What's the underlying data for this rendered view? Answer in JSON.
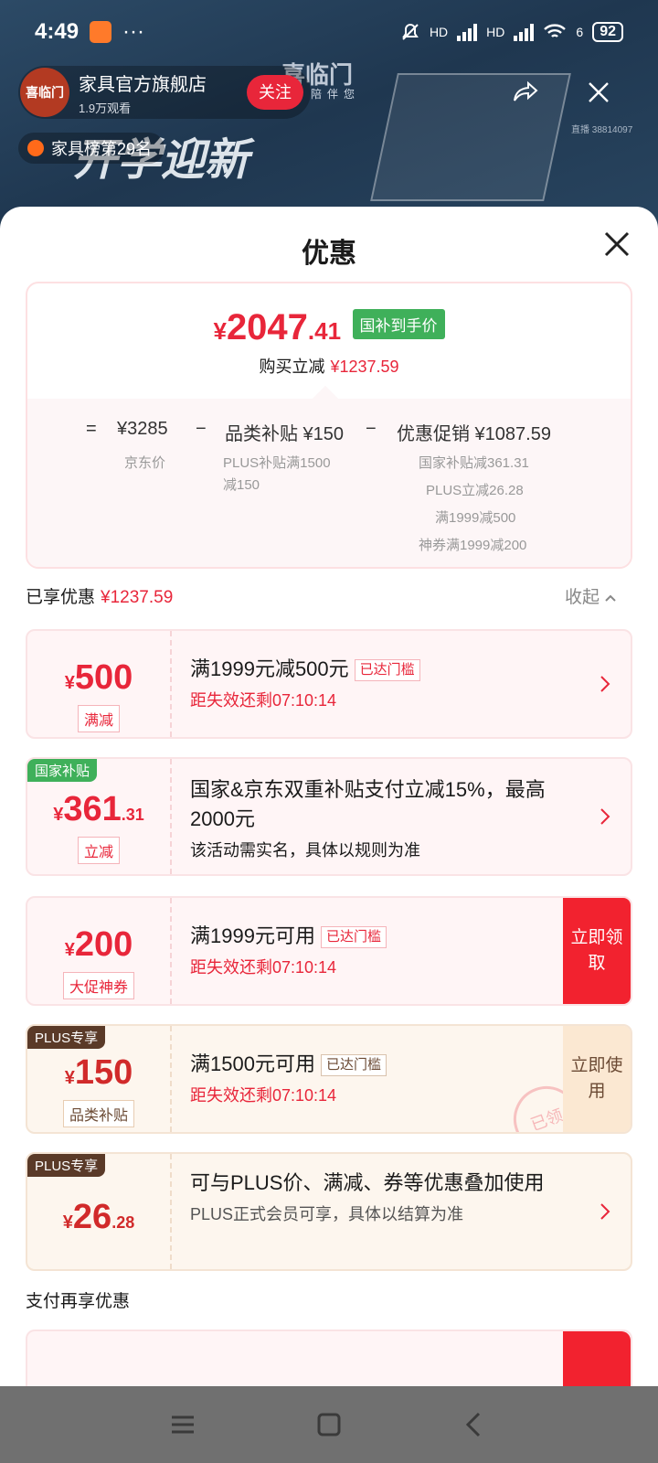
{
  "status_bar": {
    "time": "4:49",
    "hd1": "HD",
    "hd2": "HD",
    "wifi_num": "6",
    "battery": "92"
  },
  "live": {
    "store_name": "家具官方旗舰店",
    "views": "1.9万观看",
    "follow_label": "关注",
    "rank_label": "家具榜第29名",
    "brand": "喜临门",
    "brand_sub": "陪伴您",
    "banner_text": "开学迎新",
    "room_id": "直播 38814097",
    "logo_text": "喜临门"
  },
  "sheet": {
    "title": "优惠",
    "price": {
      "currency": "¥",
      "integer": "2047",
      "decimal": ".41",
      "tag": "国补到手价",
      "reduce_label": "购买立减",
      "reduce_value": "¥1237.59"
    },
    "equation": {
      "eq": "=",
      "base_price": "¥3285",
      "base_label": "京东价",
      "minus1": "−",
      "category_label": "品类补贴 ¥150",
      "category_sub1": "PLUS补贴满1500",
      "category_sub2": "减150",
      "minus2": "−",
      "promo_label": "优惠促销 ¥1087.59",
      "promo_sub1": "国家补贴减361.31",
      "promo_sub2": "PLUS立减26.28",
      "promo_sub3": "满1999减500",
      "promo_sub4": "神券满1999减200"
    },
    "applied_label": "已享优惠",
    "applied_value": "¥1237.59",
    "collapse_label": "收起",
    "cards": [
      {
        "currency": "¥",
        "amount": "500",
        "decimal": "",
        "type": "满减",
        "ribbon": "",
        "title": "满1999元减500元",
        "badge": "已达门槛",
        "sub": "距失效还剩07:10:14",
        "action": ""
      },
      {
        "currency": "¥",
        "amount": "361",
        "decimal": ".31",
        "type": "立减",
        "ribbon": "国家补贴",
        "title": "国家&京东双重补贴支付立减15%，最高2000元",
        "badge": "",
        "sub": "该活动需实名，具体以规则为准",
        "action": ""
      },
      {
        "currency": "¥",
        "amount": "200",
        "decimal": "",
        "type": "大促神券",
        "ribbon": "",
        "title": "满1999元可用",
        "badge": "已达门槛",
        "sub": "距失效还剩07:10:14",
        "action": "立即领取"
      },
      {
        "currency": "¥",
        "amount": "150",
        "decimal": "",
        "type": "品类补贴",
        "ribbon": "PLUS专享",
        "title": "满1500元可用",
        "badge": "已达门槛",
        "sub": "距失效还剩07:10:14",
        "action": "立即使用",
        "stamp": "已领"
      },
      {
        "currency": "¥",
        "amount": "26",
        "decimal": ".28",
        "type": "",
        "ribbon": "PLUS专享",
        "title": "可与PLUS价、满减、券等优惠叠加使用",
        "badge": "",
        "sub": "PLUS正式会员可享，具体以结算为准",
        "action": ""
      }
    ],
    "pay_label": "支付再享优惠"
  },
  "colors": {
    "accent": "#e8263a",
    "green_tag": "#3fb05a",
    "plus_brown": "#5a3a28"
  }
}
